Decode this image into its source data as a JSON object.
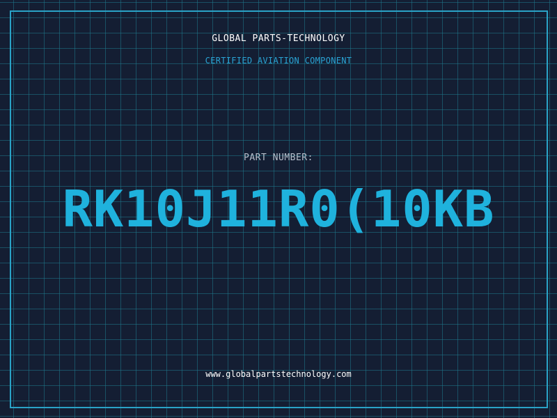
{
  "company_name": "GLOBAL PARTS-TECHNOLOGY",
  "tagline": "CERTIFIED AVIATION COMPONENT",
  "part_number_label": "PART NUMBER:",
  "part_number": "RK10J11R0(10KB",
  "website": "www.globalpartstechnology.com",
  "colors": {
    "background": "#141e33",
    "grid": "#1e788c",
    "border": "#2aa3c7",
    "accent": "#1fb2dd",
    "tagline": "#2aa3d4"
  }
}
